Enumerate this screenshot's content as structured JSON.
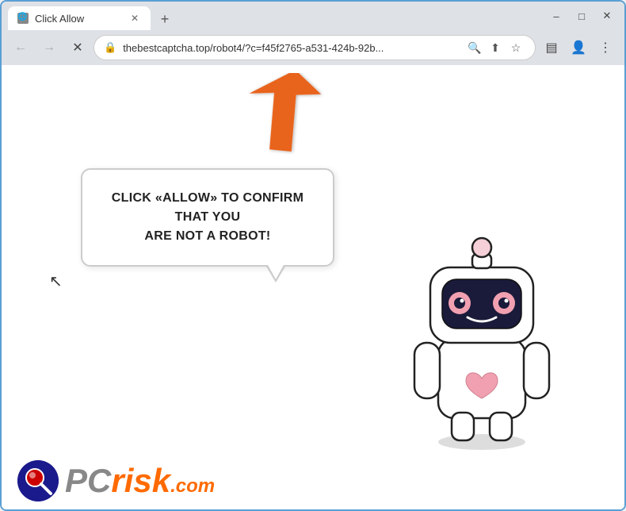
{
  "browser": {
    "tab": {
      "title": "Click Allow",
      "favicon": "🌐"
    },
    "new_tab_label": "+",
    "window_controls": {
      "minimize": "–",
      "maximize": "□",
      "close": "✕"
    },
    "nav": {
      "back": "←",
      "forward": "→",
      "reload": "✕",
      "address": "thebestcaptcha.top/robot4/?c=f45f2765-a531-424b-92b...",
      "lock_icon": "🔒",
      "search_icon": "🔍",
      "share_icon": "⬆",
      "star_icon": "☆",
      "sidebar_icon": "▤",
      "profile_icon": "👤",
      "menu_icon": "⋮"
    }
  },
  "page": {
    "bubble_text_line1": "CLICK «ALLOW» TO CONFIRM THAT YOU",
    "bubble_text_line2": "ARE NOT A ROBOT!",
    "arrow_color": "#e8631a"
  },
  "pcrisk": {
    "text_gray": "PC",
    "text_orange": "risk",
    "dot_com": ".com"
  }
}
